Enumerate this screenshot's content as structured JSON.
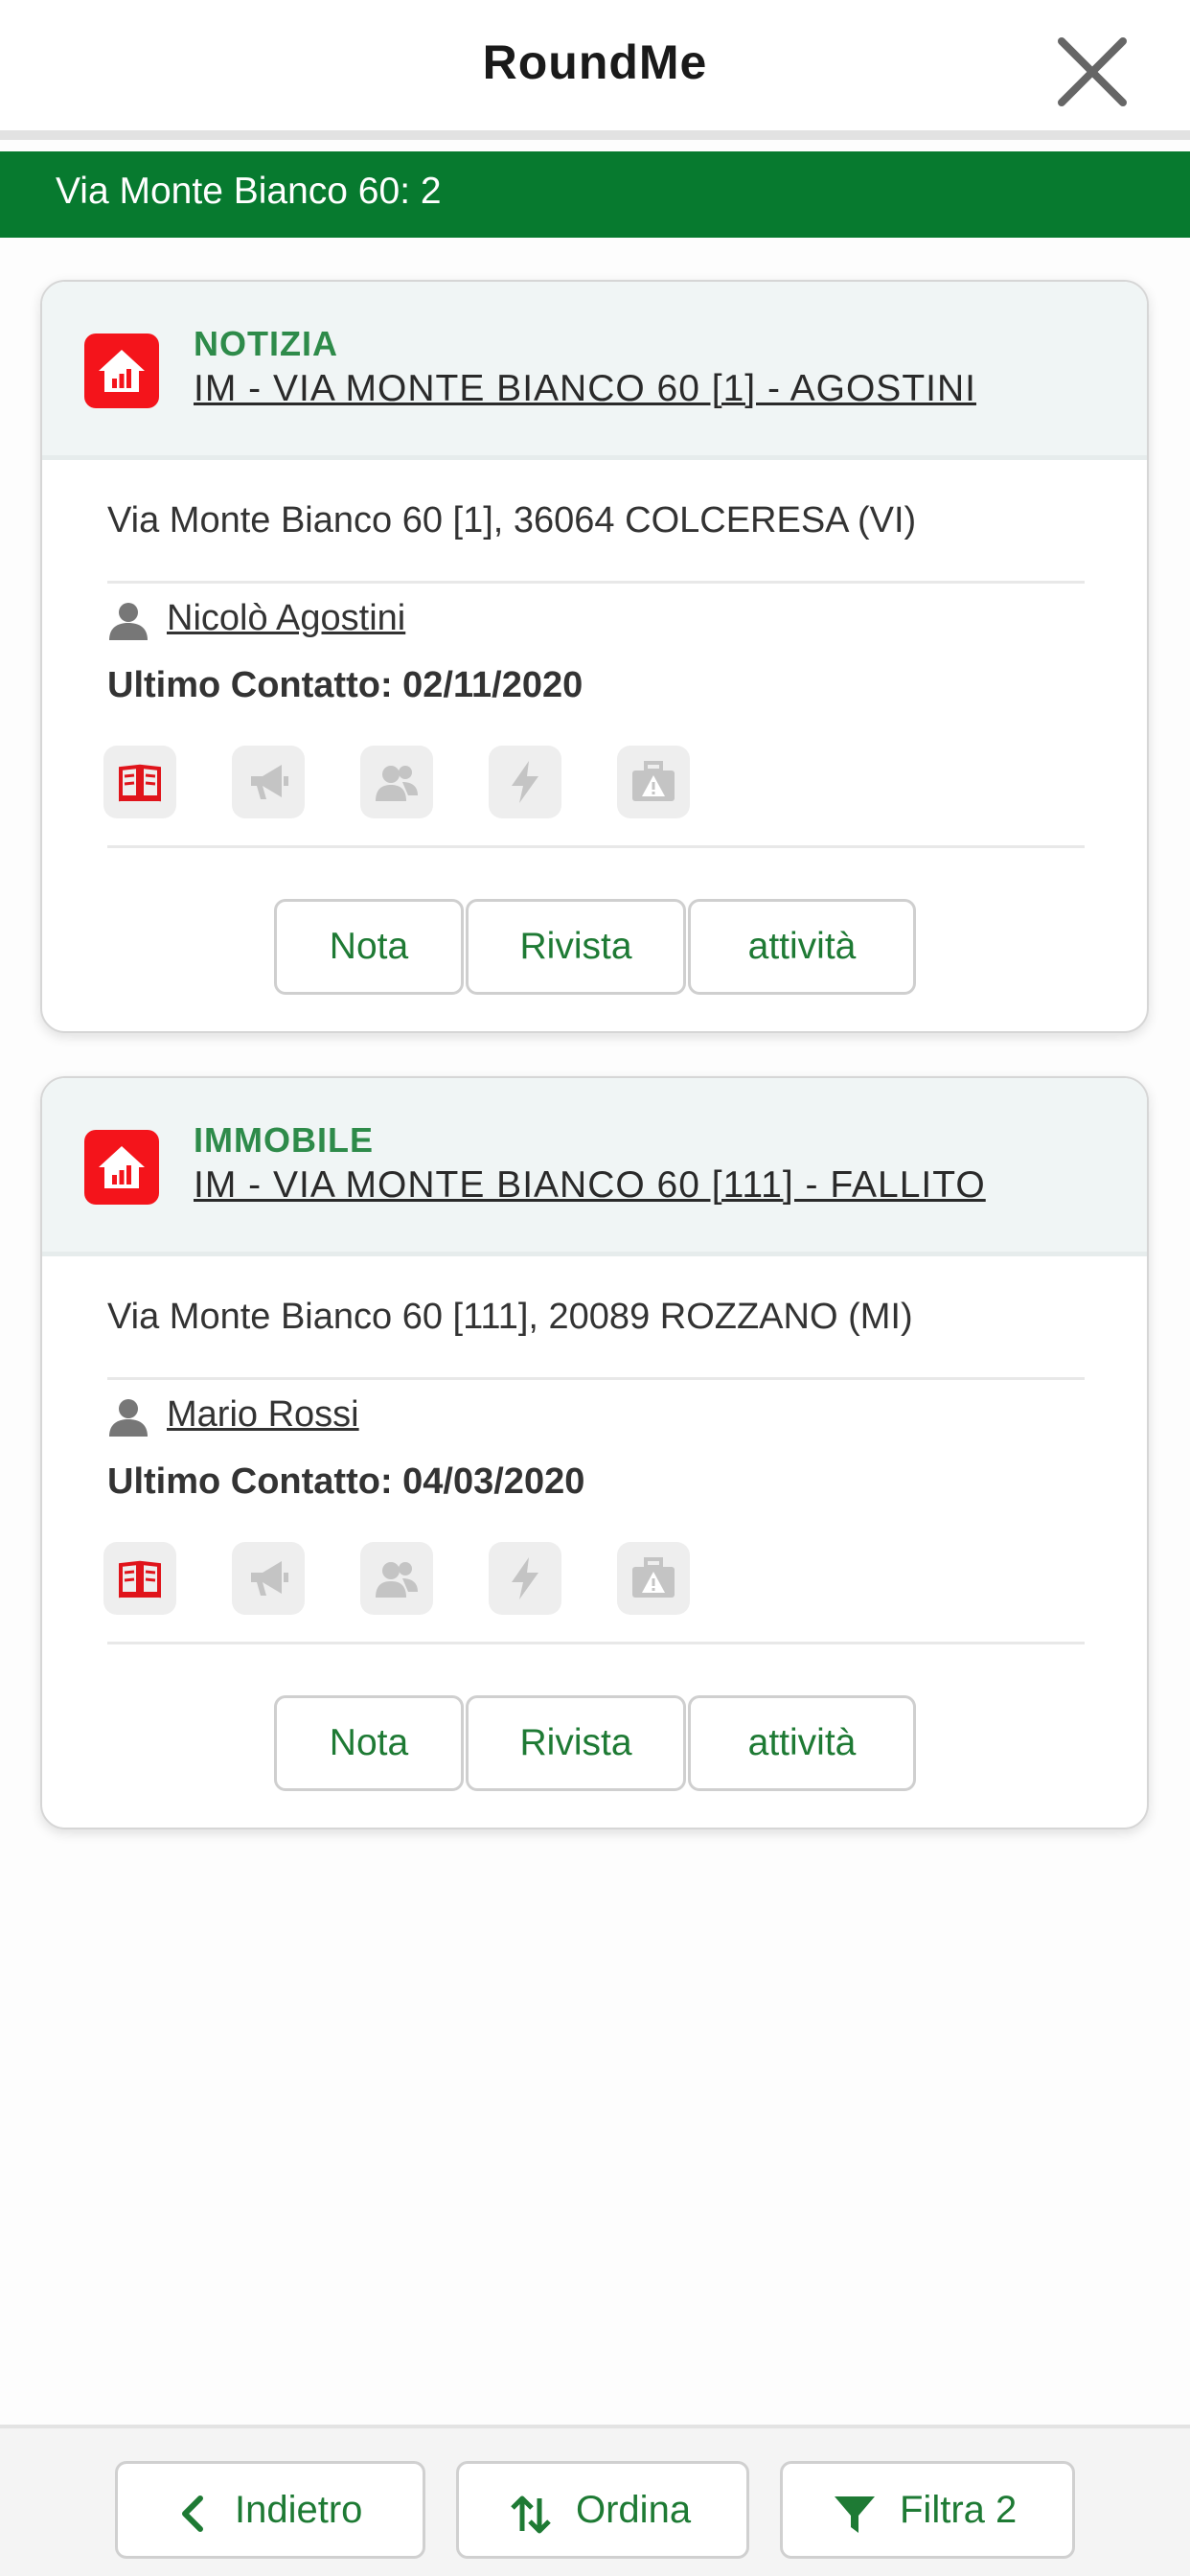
{
  "header": {
    "title": "RoundMe",
    "close_icon": "close-icon"
  },
  "banner": {
    "text": "Via Monte Bianco 60: 2"
  },
  "colors": {
    "brand_green": "#077a2f",
    "accent_red": "#f4141b",
    "label_green": "#2e8b4a"
  },
  "cards": [
    {
      "type": "NOTIZIA",
      "title": "IM - VIA MONTE BIANCO 60 [1] - AGOSTINI",
      "address": "Via Monte Bianco 60 [1], 36064 COLCERESA (VI)",
      "person": "Nicolò Agostini",
      "last_contact": "Ultimo Contatto: 02/11/2020",
      "icons": [
        "book-icon",
        "megaphone-icon",
        "contacts-icon",
        "lightning-icon",
        "briefcase-alert-icon"
      ],
      "buttons": {
        "nota": "Nota",
        "rivista": "Rivista",
        "attivita": "attività"
      }
    },
    {
      "type": "IMMOBILE",
      "title": "IM - VIA MONTE BIANCO 60 [111] - FALLITO",
      "address": "Via Monte Bianco 60 [111], 20089 ROZZANO (MI)",
      "person": "Mario Rossi",
      "last_contact": "Ultimo Contatto: 04/03/2020",
      "icons": [
        "book-icon",
        "megaphone-icon",
        "contacts-icon",
        "lightning-icon",
        "briefcase-alert-icon"
      ],
      "buttons": {
        "nota": "Nota",
        "rivista": "Rivista",
        "attivita": "attività"
      }
    }
  ],
  "toolbar": {
    "back_label": "Indietro",
    "sort_label": "Ordina",
    "filter_label": "Filtra 2"
  }
}
